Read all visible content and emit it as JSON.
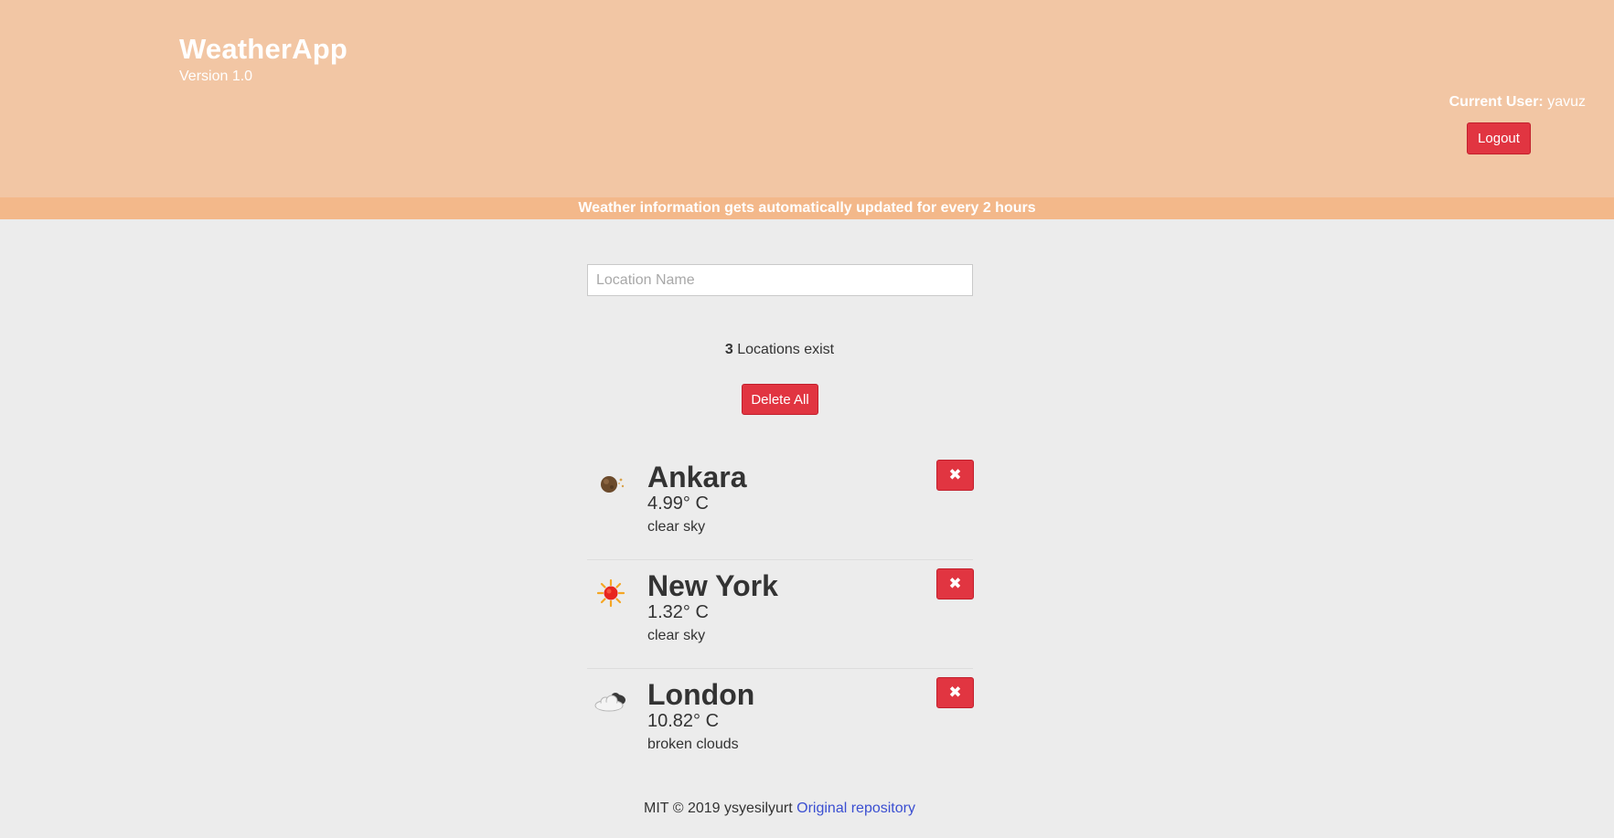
{
  "header": {
    "title": "WeatherApp",
    "version": "Version 1.0",
    "current_user_label": "Current User:",
    "current_user": "yavuz",
    "logout_label": "Logout"
  },
  "banner": {
    "text": "Weather information gets automatically updated for every 2 hours"
  },
  "search": {
    "placeholder": "Location Name",
    "value": ""
  },
  "summary": {
    "count": "3",
    "count_suffix": "Locations exist",
    "delete_all_label": "Delete All"
  },
  "locations": [
    {
      "name": "Ankara",
      "temp": "4.99° C",
      "description": "clear sky",
      "icon": "moon-icon",
      "remove_label": "✖"
    },
    {
      "name": "New York",
      "temp": "1.32° C",
      "description": "clear sky",
      "icon": "sun-icon",
      "remove_label": "✖"
    },
    {
      "name": "London",
      "temp": "10.82° C",
      "description": "broken clouds",
      "icon": "cloud-icon",
      "remove_label": "✖"
    }
  ],
  "footer": {
    "text": "MIT © 2019 ysyesilyurt",
    "link_label": "Original repository"
  },
  "colors": {
    "header_bg": "#f2c6a4",
    "banner_bg": "#f3b88a",
    "danger": "#e13541",
    "link": "#3b4fd1"
  }
}
